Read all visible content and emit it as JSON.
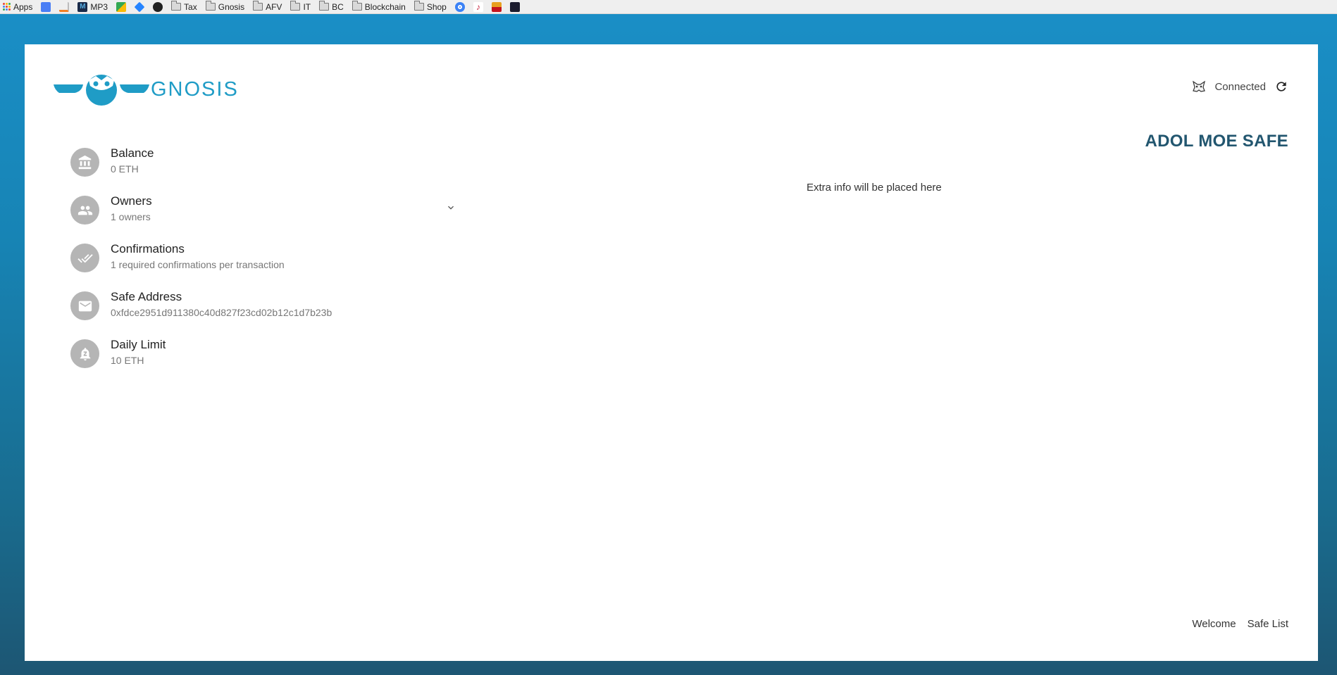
{
  "bookmarks": [
    {
      "label": "Apps",
      "icon": "apps-grid-icon"
    },
    {
      "label": "",
      "icon": "translate-icon",
      "color": "#4a7ef5"
    },
    {
      "label": "",
      "icon": "stackoverflow-icon",
      "color": "#f48024"
    },
    {
      "label": "MP3",
      "icon": "m-square-icon",
      "color": "#1a2b4a"
    },
    {
      "label": "",
      "icon": "maps-icon",
      "color": "#34a853"
    },
    {
      "label": "",
      "icon": "diamond-icon",
      "color": "#2684ff"
    },
    {
      "label": "",
      "icon": "github-icon",
      "color": "#222222"
    },
    {
      "label": "Tax",
      "icon": "folder-icon"
    },
    {
      "label": "Gnosis",
      "icon": "folder-icon"
    },
    {
      "label": "AFV",
      "icon": "folder-icon"
    },
    {
      "label": "IT",
      "icon": "folder-icon"
    },
    {
      "label": "BC",
      "icon": "folder-icon"
    },
    {
      "label": "Blockchain",
      "icon": "folder-icon"
    },
    {
      "label": "Shop",
      "icon": "folder-icon"
    },
    {
      "label": "",
      "icon": "circle-icon",
      "color": "#3b82f6"
    },
    {
      "label": "",
      "icon": "music-icon",
      "color": "#c41e3a"
    },
    {
      "label": "",
      "icon": "news-icon",
      "color": "#e8a020"
    },
    {
      "label": "",
      "icon": "dark-app-icon",
      "color": "#1c1c2e"
    }
  ],
  "header": {
    "logo_text": "GNOSIS",
    "status_label": "Connected"
  },
  "safe": {
    "title": "ADOL MOE SAFE",
    "extra_info": "Extra info will be placed here",
    "details": [
      {
        "title": "Balance",
        "value": "0 ETH",
        "icon": "bank-icon"
      },
      {
        "title": "Owners",
        "value": "1 owners",
        "icon": "people-icon"
      },
      {
        "title": "Confirmations",
        "value": "1 required confirmations per transaction",
        "icon": "double-check-icon"
      },
      {
        "title": "Safe Address",
        "value": "0xfdce2951d911380c40d827f23cd02b12c1d7b23b",
        "icon": "mail-icon"
      },
      {
        "title": "Daily Limit",
        "value": "10 ETH",
        "icon": "alarm-bell-icon"
      }
    ]
  },
  "footer": {
    "welcome": "Welcome",
    "safe_list": "Safe List"
  },
  "colors": {
    "brand": "#1f9cc6",
    "title": "#22566f",
    "avatar": "#b5b5b5",
    "background_top": "#1a8fc7",
    "background_bottom": "#1d5673"
  }
}
